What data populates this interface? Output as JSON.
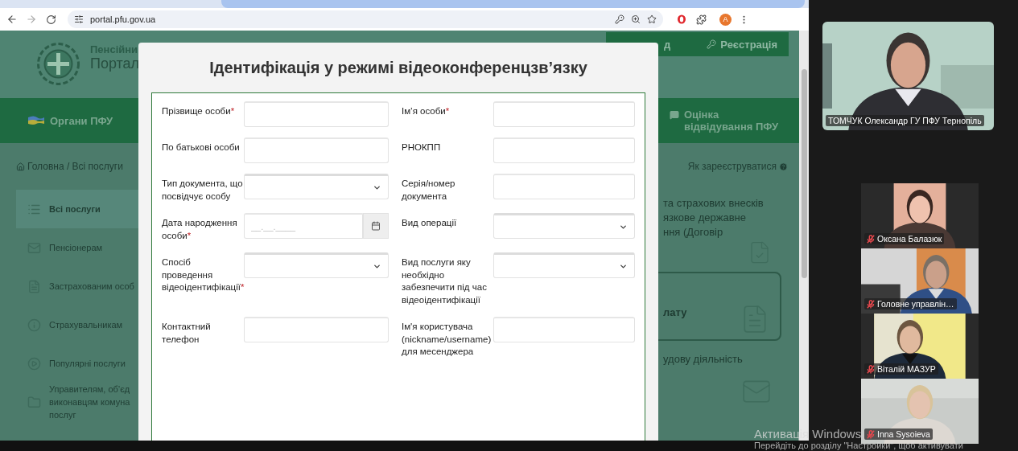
{
  "browser": {
    "url": "portal.pfu.gov.ua",
    "profile_initial": "A"
  },
  "site": {
    "logo_title": "Пенсійни",
    "logo_subtitle": "Портал",
    "header_buttons": [
      {
        "label": "д",
        "kind": "plain"
      },
      {
        "label": "Реєстрація",
        "kind": "key"
      }
    ],
    "nav": [
      {
        "label": "Органи ПФУ",
        "kind": "flag"
      },
      {
        "label": "Оцінка\nвідвідування ПФУ",
        "kind": "chat"
      }
    ],
    "breadcrumb": "Головна / Всі послуги",
    "help_link": "Як зареєструватися",
    "sidebar": [
      {
        "label": "Всі послуги",
        "selected": true
      },
      {
        "label": "Пенсіонерам",
        "selected": false
      },
      {
        "label": "Застрахованим особ",
        "selected": false
      },
      {
        "label": "Страхувальникам",
        "selected": false
      },
      {
        "label": "Популярні послуги",
        "selected": false
      },
      {
        "label": "Управителям, об’єд\nвиконавцям комуна\nпослуг",
        "selected": false
      }
    ],
    "cards": [
      {
        "text": "та страхових внесків\nязкове державне\nння (Договір",
        "outlined": false
      },
      {
        "text": "лату",
        "outlined": true
      },
      {
        "text": "удову діяльність",
        "outlined": false
      }
    ]
  },
  "modal": {
    "title": "Ідентифікація у режимі відеоконференцзв’язку",
    "required_mark": "*",
    "rows": [
      {
        "left": {
          "label": "Прізвище особи",
          "required": true,
          "kind": "text"
        },
        "right": {
          "label": "Ім’я особи",
          "required": true,
          "kind": "text"
        }
      },
      {
        "left": {
          "label": "По батькові особи",
          "required": false,
          "kind": "text"
        },
        "right": {
          "label": "РНОКПП",
          "required": false,
          "kind": "text"
        }
      },
      {
        "left": {
          "label": "Тип документа, що посвідчує особу",
          "required": false,
          "kind": "select"
        },
        "right": {
          "label": "Серія/номер документа",
          "required": false,
          "kind": "text"
        }
      },
      {
        "left": {
          "label": "Дата народження особи",
          "required": true,
          "kind": "date",
          "placeholder": "__.__.____"
        },
        "right": {
          "label": "Вид операції",
          "required": false,
          "kind": "select"
        }
      },
      {
        "left": {
          "label": "Спосіб проведення відеоідентифікації",
          "required": true,
          "kind": "select"
        },
        "right": {
          "label": "Вид послуги яку необхідно забезпечити під час відеоідентифікації",
          "required": false,
          "kind": "select"
        }
      },
      {
        "left": {
          "label": "Контактний телефон",
          "required": false,
          "kind": "text"
        },
        "right": {
          "label": "Ім'я користувача (nickname/username) для месенджера",
          "required": false,
          "kind": "text"
        }
      }
    ]
  },
  "conference": {
    "tiles": [
      {
        "name": "ТОМЧУК Олександр ГУ ПФУ Тернопіль",
        "kind": "main",
        "muted": false
      },
      {
        "name": "Оксана Балазюк",
        "kind": "thumb",
        "muted": true
      },
      {
        "name": "Головне управлін…",
        "kind": "thumb",
        "muted": true
      },
      {
        "name": "Віталій МАЗУР",
        "kind": "thumb",
        "muted": true
      },
      {
        "name": "Inna Sysoieva",
        "kind": "thumb",
        "muted": true
      }
    ]
  },
  "os_notice": {
    "title": "Активація Windows",
    "text": "Перейдіть до розділу \"Настройки\", щоб активувати"
  }
}
